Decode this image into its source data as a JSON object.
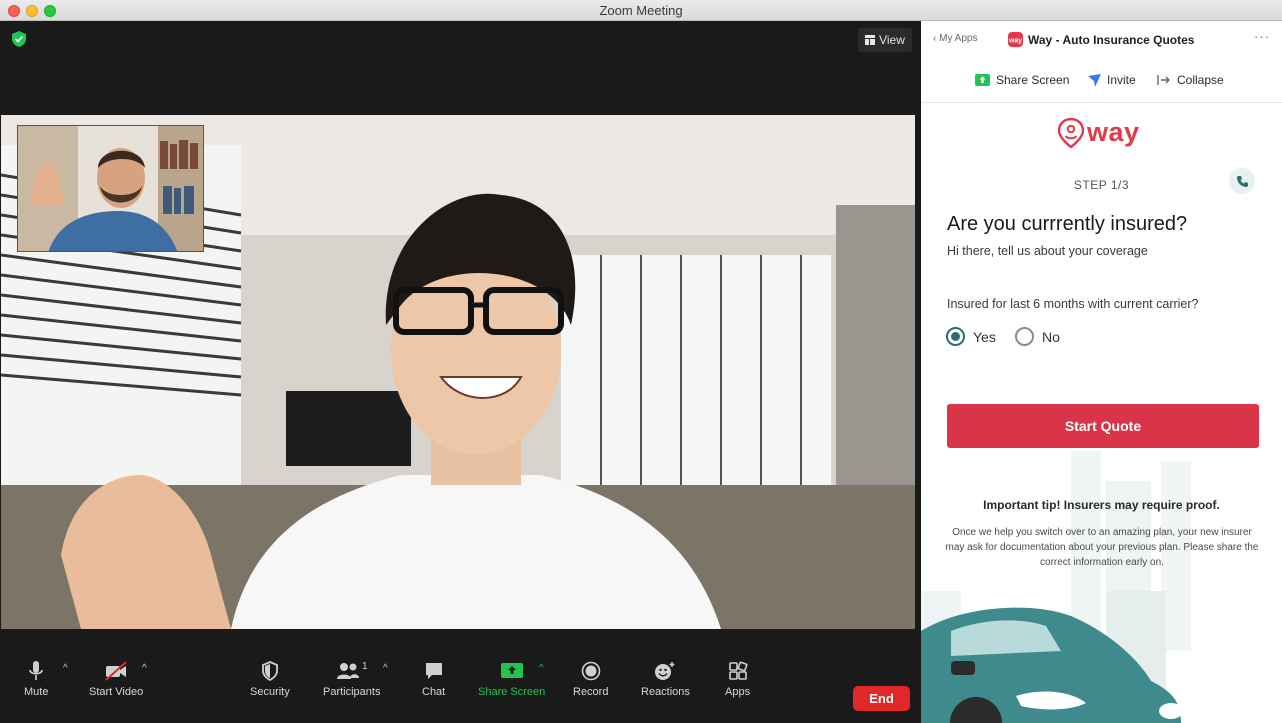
{
  "window": {
    "title": "Zoom Meeting"
  },
  "meeting": {
    "view_label": "View"
  },
  "toolbar": {
    "items": [
      {
        "label": "Mute",
        "icon": "microphone-icon"
      },
      {
        "label": "Start Video",
        "icon": "video-off-icon"
      },
      {
        "label": "Security",
        "icon": "security-shield-icon"
      },
      {
        "label": "Participants",
        "icon": "participants-icon",
        "count": "1"
      },
      {
        "label": "Chat",
        "icon": "chat-icon"
      },
      {
        "label": "Share Screen",
        "icon": "share-screen-icon"
      },
      {
        "label": "Record",
        "icon": "record-icon"
      },
      {
        "label": "Reactions",
        "icon": "reactions-icon"
      },
      {
        "label": "Apps",
        "icon": "apps-icon"
      }
    ],
    "end_label": "End"
  },
  "panel": {
    "back_label": "My Apps",
    "app_title": "Way - Auto Insurance Quotes",
    "more": "···",
    "actions": {
      "share_screen": "Share Screen",
      "invite": "Invite",
      "collapse": "Collapse"
    },
    "brand": "way",
    "step": "STEP 1/3",
    "question_title": "Are you currrently insured?",
    "question_subtitle": "Hi there, tell us about your coverage",
    "field_label": "Insured for last 6 months with current carrier?",
    "options": {
      "yes": "Yes",
      "no": "No"
    },
    "selected": "Yes",
    "cta": "Start Quote",
    "tip_title": "Important tip! Insurers may require proof.",
    "tip_body": "Once we help you switch over to an amazing plan, your new insurer may ask for documentation about your previous plan. Please share the correct information early on."
  },
  "colors": {
    "brand_red": "#e23a4a",
    "cta_red": "#d93448",
    "radio_teal": "#2e6b73",
    "share_green": "#23c552",
    "end_red": "#e02828"
  }
}
